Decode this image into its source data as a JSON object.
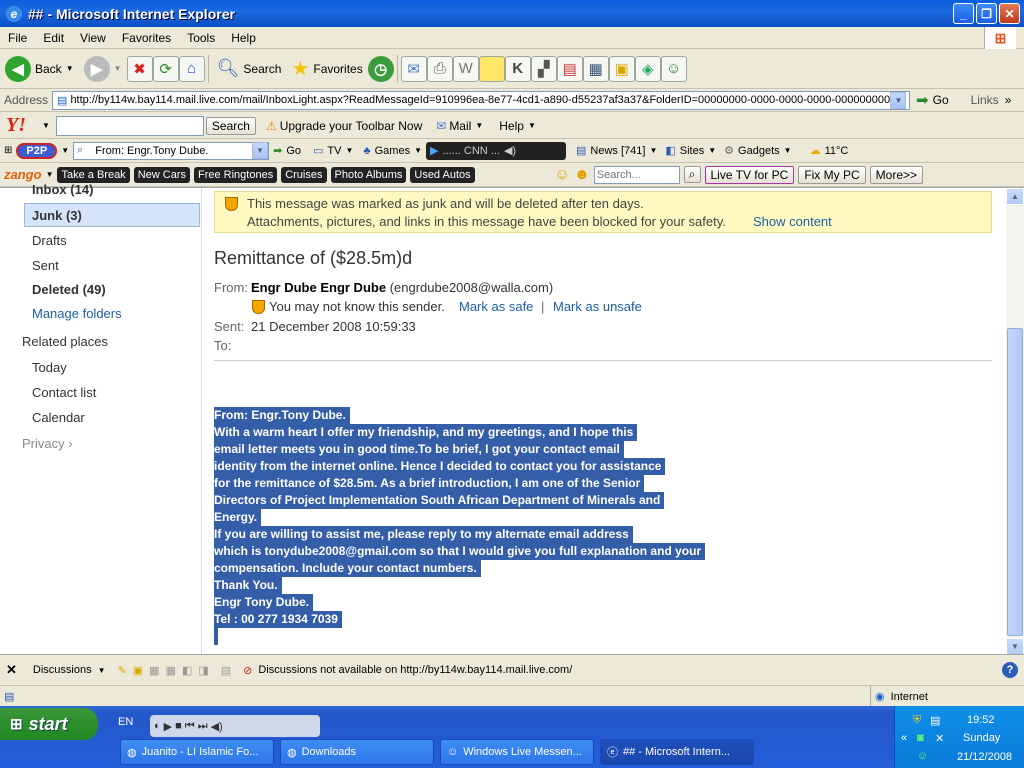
{
  "window": {
    "title": "## - Microsoft Internet Explorer"
  },
  "menu": [
    "File",
    "Edit",
    "View",
    "Favorites",
    "Tools",
    "Help"
  ],
  "toolbar": {
    "back": "Back",
    "search": "Search",
    "favorites": "Favorites"
  },
  "address": {
    "label": "Address",
    "url": "http://by114w.bay114.mail.live.com/mail/InboxLight.aspx?ReadMessageId=910996ea-8e77-4cd1-a890-d55237af3a37&FolderID=00000000-0000-0000-0000-000000000",
    "go": "Go",
    "links": "Links"
  },
  "yahoo": {
    "search_btn": "Search",
    "upgrade": "Upgrade your Toolbar Now",
    "mail": "Mail",
    "help": "Help"
  },
  "toolbar3": {
    "p2p": "P2P",
    "from_field": "From: Engr.Tony Dube.",
    "go": "Go",
    "tv": "TV",
    "games": "Games",
    "cnn": "...... CNN ...",
    "news": "News [741]",
    "sites": "Sites",
    "gadgets": "Gadgets",
    "temp": "11°C"
  },
  "zango": {
    "logo": "zango",
    "items": [
      "Take a Break",
      "New Cars",
      "Free Ringtones",
      "Cruises",
      "Photo Albums",
      "Used Autos"
    ],
    "search_placeholder": "Search...",
    "livetv": "Live TV for PC",
    "fixpc": "Fix My PC",
    "more": "More>>"
  },
  "sidebar": {
    "inbox": "Inbox (14)",
    "junk": "Junk (3)",
    "drafts": "Drafts",
    "sent": "Sent",
    "deleted": "Deleted (49)",
    "manage": "Manage folders",
    "related": "Related places",
    "today": "Today",
    "contacts": "Contact list",
    "calendar": "Calendar",
    "privacy": "Privacy"
  },
  "banner": {
    "line1": "This message was marked as junk and will be deleted after ten days.",
    "line2": "Attachments, pictures, and links in this message have been blocked for your safety.",
    "show": "Show content"
  },
  "message": {
    "subject": "Remittance of ($28.5m)d",
    "from_label": "From:",
    "from_name": "Engr Dube Engr Dube",
    "from_email": "(engrdube2008@walla.com)",
    "warning": "You may not know this sender.",
    "mark_safe": "Mark as safe",
    "pipe": "|",
    "mark_unsafe": "Mark as unsafe",
    "sent_label": "Sent:",
    "sent_value": "21 December 2008 10:59:33",
    "to_label": "To:",
    "body": [
      "From: Engr.Tony Dube.",
      "With a warm heart I offer my friendship, and my greetings, and I hope this",
      "email letter meets you in good time.To be brief, I got your contact email",
      "identity from the internet online. Hence I decided to contact you for assistance",
      "for the remittance of $28.5m. As a brief introduction, I am one of the Senior",
      "Directors of Project Implementation South African Department of Minerals and",
      "Energy.",
      "If you are willing to assist me, please reply to my alternate email address",
      "which is tonydube2008@gmail.com so that I would give you full explanation and your",
      "compensation. Include your contact numbers.",
      "Thank You.",
      "Engr Tony Dube.",
      "Tel : 00 277 1934 7039"
    ]
  },
  "discuss": {
    "label": "Discussions",
    "notice": "Discussions not available on http://by114w.bay114.mail.live.com/"
  },
  "status": {
    "zone": "Internet"
  },
  "taskbar": {
    "start": "start",
    "lang": "EN",
    "tasks": [
      "Juanito - LI Islamic Fo...",
      "Downloads",
      "Windows Live Messen...",
      "## - Microsoft Intern..."
    ],
    "time": "19:52",
    "day": "Sunday",
    "date": "21/12/2008"
  }
}
